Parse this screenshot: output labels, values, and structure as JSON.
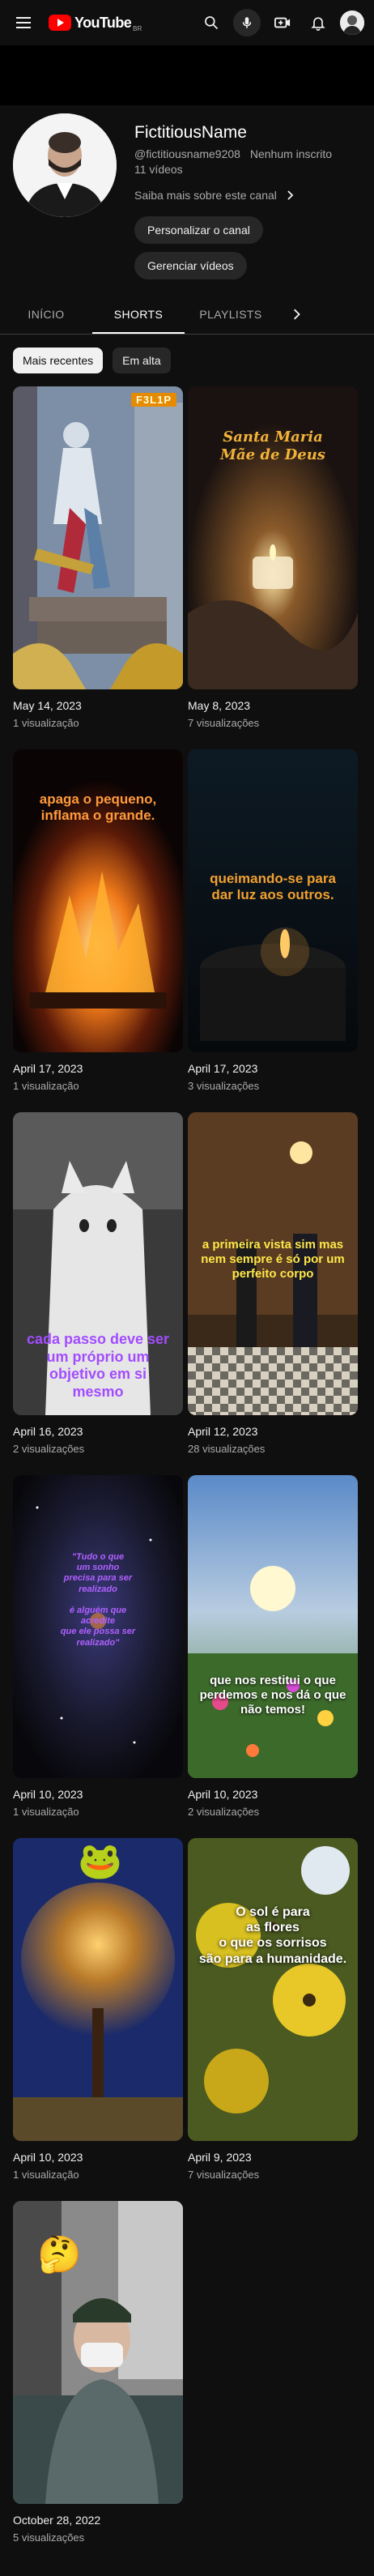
{
  "header": {
    "logo_text": "YouTube",
    "country": "BR"
  },
  "channel": {
    "name": "FictitiousName",
    "handle": "@fictitiousname9208",
    "subscribers": "Nenhum inscrito",
    "videos": "11 vídeos",
    "about": "Saiba mais sobre este canal",
    "customize_label": "Personalizar o canal",
    "manage_label": "Gerenciar vídeos"
  },
  "tabs": [
    {
      "label": "INÍCIO"
    },
    {
      "label": "SHORTS"
    },
    {
      "label": "PLAYLISTS"
    }
  ],
  "chips": [
    {
      "label": "Mais recentes"
    },
    {
      "label": "Em alta"
    }
  ],
  "shorts": [
    {
      "date": "May 14, 2023",
      "views": "1 visualização",
      "badge": "F3L1P"
    },
    {
      "date": "May 8, 2023",
      "views": "7 visualizações",
      "overlay": "Santa Maria\nMãe de Deus"
    },
    {
      "date": "April 17, 2023",
      "views": "1 visualização",
      "overlay": "apaga o pequeno,\ninflama o grande."
    },
    {
      "date": "April 17, 2023",
      "views": "3 visualizações",
      "overlay": "queimando-se para\ndar luz aos outros."
    },
    {
      "date": "April 16, 2023",
      "views": "2 visualizações",
      "overlay": "cada passo deve ser\num próprio um\nobjetivo em si\nmesmo"
    },
    {
      "date": "April 12, 2023",
      "views": "28 visualizações",
      "overlay": "a primeira vista sim mas\nnem sempre é só por um\nperfeito corpo"
    },
    {
      "date": "April 10, 2023",
      "views": "1 visualização",
      "overlay": "\"Tudo o que\num sonho\nprecisa para ser\nrealizado\n\né alguém que\nacredite\nque ele possa ser\nrealizado\""
    },
    {
      "date": "April 10, 2023",
      "views": "2 visualizações",
      "overlay": "que nos restitui o que\nperdemos e nos dá o que\nnão temos!"
    },
    {
      "date": "April 10, 2023",
      "views": "1 visualização"
    },
    {
      "date": "April 9, 2023",
      "views": "7 visualizações",
      "overlay": "O sol é para\nas flores\no que os sorrisos\nsão para a humanidade."
    },
    {
      "date": "October 28, 2022",
      "views": "5 visualizações"
    }
  ],
  "colors": {
    "background": "#0f0f0f",
    "brand_red": "#ff0000",
    "text_secondary": "#aaaaaa",
    "chip_bg": "#272727"
  }
}
